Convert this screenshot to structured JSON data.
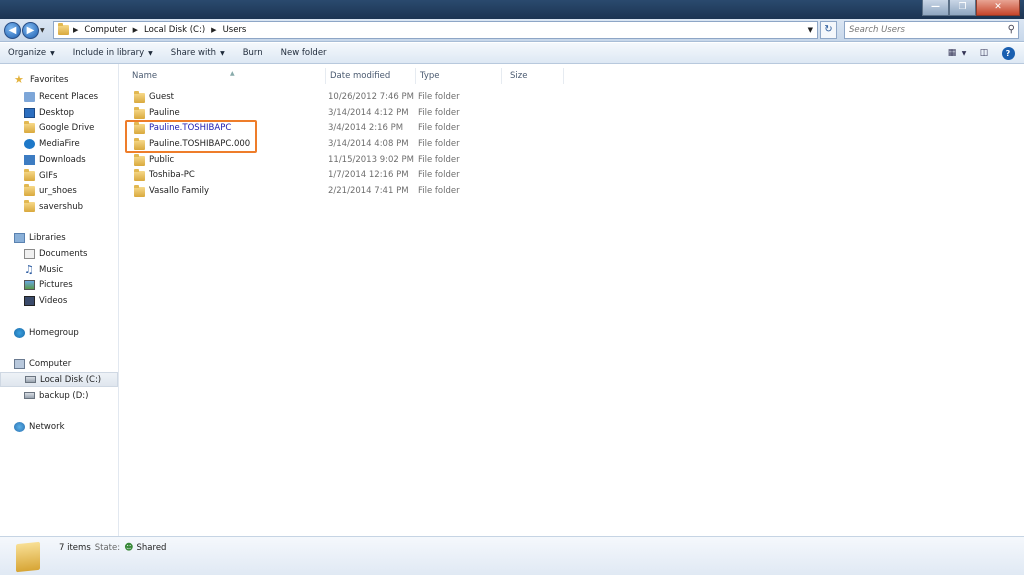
{
  "window": {
    "controls": {
      "minimize": "—",
      "maximize": "❐",
      "close": "✕"
    }
  },
  "address": {
    "crumbs": [
      "Computer",
      "Local Disk (C:)",
      "Users"
    ]
  },
  "search": {
    "placeholder": "Search Users"
  },
  "toolbar": {
    "organize": "Organize",
    "include_in_library": "Include in library",
    "share_with": "Share with",
    "burn": "Burn",
    "new_folder": "New folder"
  },
  "sidebar": {
    "favorites": {
      "label": "Favorites",
      "items": [
        "Recent Places",
        "Desktop",
        "Google Drive",
        "MediaFire",
        "Downloads",
        "GIFs",
        "ur_shoes",
        "savershub"
      ]
    },
    "libraries": {
      "label": "Libraries",
      "items": [
        "Documents",
        "Music",
        "Pictures",
        "Videos"
      ]
    },
    "homegroup": {
      "label": "Homegroup"
    },
    "computer": {
      "label": "Computer",
      "items": [
        "Local Disk (C:)",
        "backup (D:)"
      ],
      "selected": "Local Disk (C:)"
    },
    "network": {
      "label": "Network"
    }
  },
  "columns": [
    "Name",
    "Date modified",
    "Type",
    "Size"
  ],
  "files": [
    {
      "name": "Guest",
      "date": "10/26/2012 7:46 PM",
      "type": "File folder"
    },
    {
      "name": "Pauline",
      "date": "3/14/2014 4:12 PM",
      "type": "File folder"
    },
    {
      "name": "Pauline.TOSHIBAPC",
      "date": "3/4/2014 2:16 PM",
      "type": "File folder"
    },
    {
      "name": "Pauline.TOSHIBAPC.000",
      "date": "3/14/2014 4:08 PM",
      "type": "File folder"
    },
    {
      "name": "Public",
      "date": "11/15/2013 9:02 PM",
      "type": "File folder"
    },
    {
      "name": "Toshiba-PC",
      "date": "1/7/2014 12:16 PM",
      "type": "File folder"
    },
    {
      "name": "Vasallo Family",
      "date": "2/21/2014 7:41 PM",
      "type": "File folder"
    }
  ],
  "status": {
    "count": "7 items",
    "state_label": "State:",
    "state_value": "Shared"
  },
  "colors": {
    "highlight": "#ee7d2a",
    "link": "#1a1ab0"
  }
}
